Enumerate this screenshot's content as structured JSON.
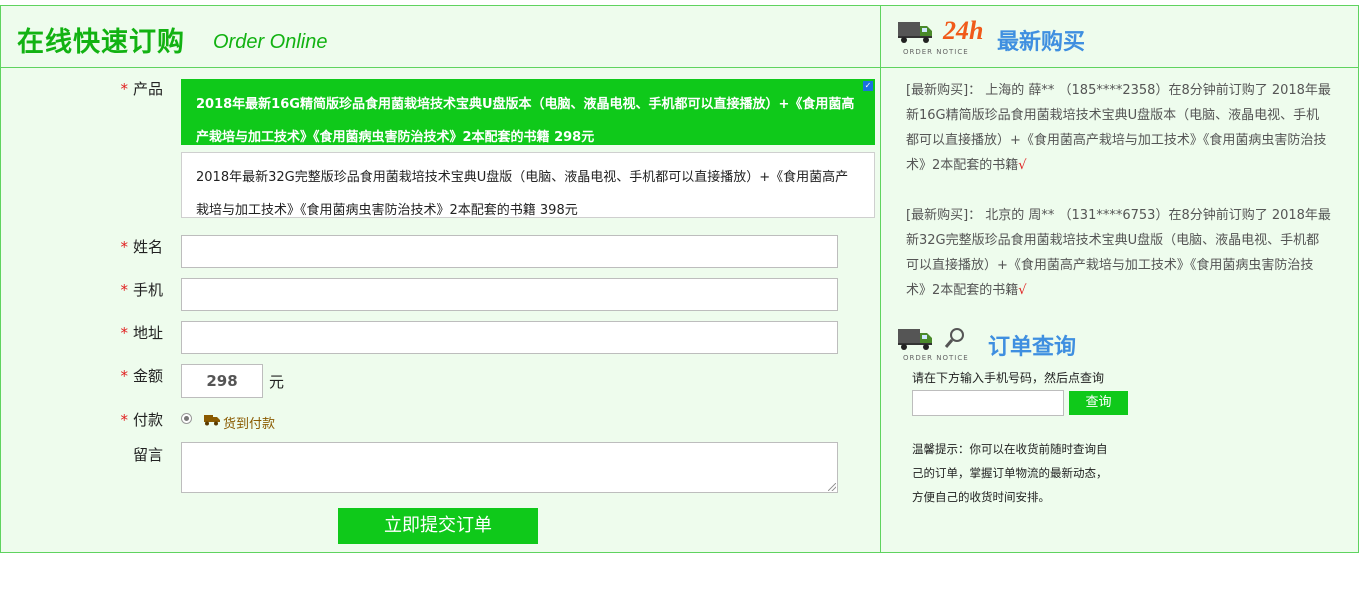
{
  "order_form": {
    "title_cn": "在线快速订购",
    "title_en": "Order Online",
    "labels": {
      "product": "产品",
      "name": "姓名",
      "phone": "手机",
      "address": "地址",
      "amount": "金额",
      "payment": "付款",
      "message": "留言"
    },
    "required_mark": "*",
    "products": [
      {
        "text": "2018年最新16G精简版珍品食用菌栽培技术宝典U盘版本（电脑、液晶电视、手机都可以直接播放）+《食用菌高产栽培与加工技术》《食用菌病虫害防治技术》2本配套的书籍  298元",
        "selected": true
      },
      {
        "text": "2018年最新32G完整版珍品食用菌栽培技术宝典U盘版（电脑、液晶电视、手机都可以直接播放）+《食用菌高产栽培与加工技术》《食用菌病虫害防治技术》2本配套的书籍  398元",
        "selected": false
      }
    ],
    "amount_value": "298",
    "amount_unit": "元",
    "payment_option": "货到付款",
    "submit_label": "立即提交订单"
  },
  "recent_orders": {
    "title": "最新购买",
    "badge": "24h",
    "notice_caption": "ORDER NOTICE",
    "items": [
      {
        "text": "[最新购买]： 上海的 薛** （185****2358）在8分钟前订购了 2018年最新16G精简版珍品食用菌栽培技术宝典U盘版本（电脑、液晶电视、手机都可以直接播放）+《食用菌高产栽培与加工技术》《食用菌病虫害防治技术》2本配套的书籍",
        "mark": "√"
      },
      {
        "text": "[最新购买]： 北京的 周** （131****6753）在8分钟前订购了 2018年最新32G完整版珍品食用菌栽培技术宝典U盘版（电脑、液晶电视、手机都可以直接播放）+《食用菌高产栽培与加工技术》《食用菌病虫害防治技术》2本配套的书籍",
        "mark": "√"
      }
    ]
  },
  "order_lookup": {
    "title": "订单查询",
    "notice_caption": "ORDER NOTICE",
    "hint": "请在下方输入手机号码，然后点查询",
    "button_label": "查询",
    "tip": "温馨提示：你可以在收货前随时查询自己的订单，掌握订单物流的最新动态，方便自己的收货时间安排。"
  },
  "colors": {
    "accent_green": "#0fc91a",
    "title_green": "#12b212",
    "border_green": "#5fd35f",
    "panel_bg": "#eefced",
    "heading_blue": "#3f8fe0",
    "badge_orange": "#f05a1a",
    "required_red": "#e02020"
  },
  "icons": [
    "truck-icon",
    "magnifier-icon",
    "check-icon",
    "radio-icon"
  ]
}
